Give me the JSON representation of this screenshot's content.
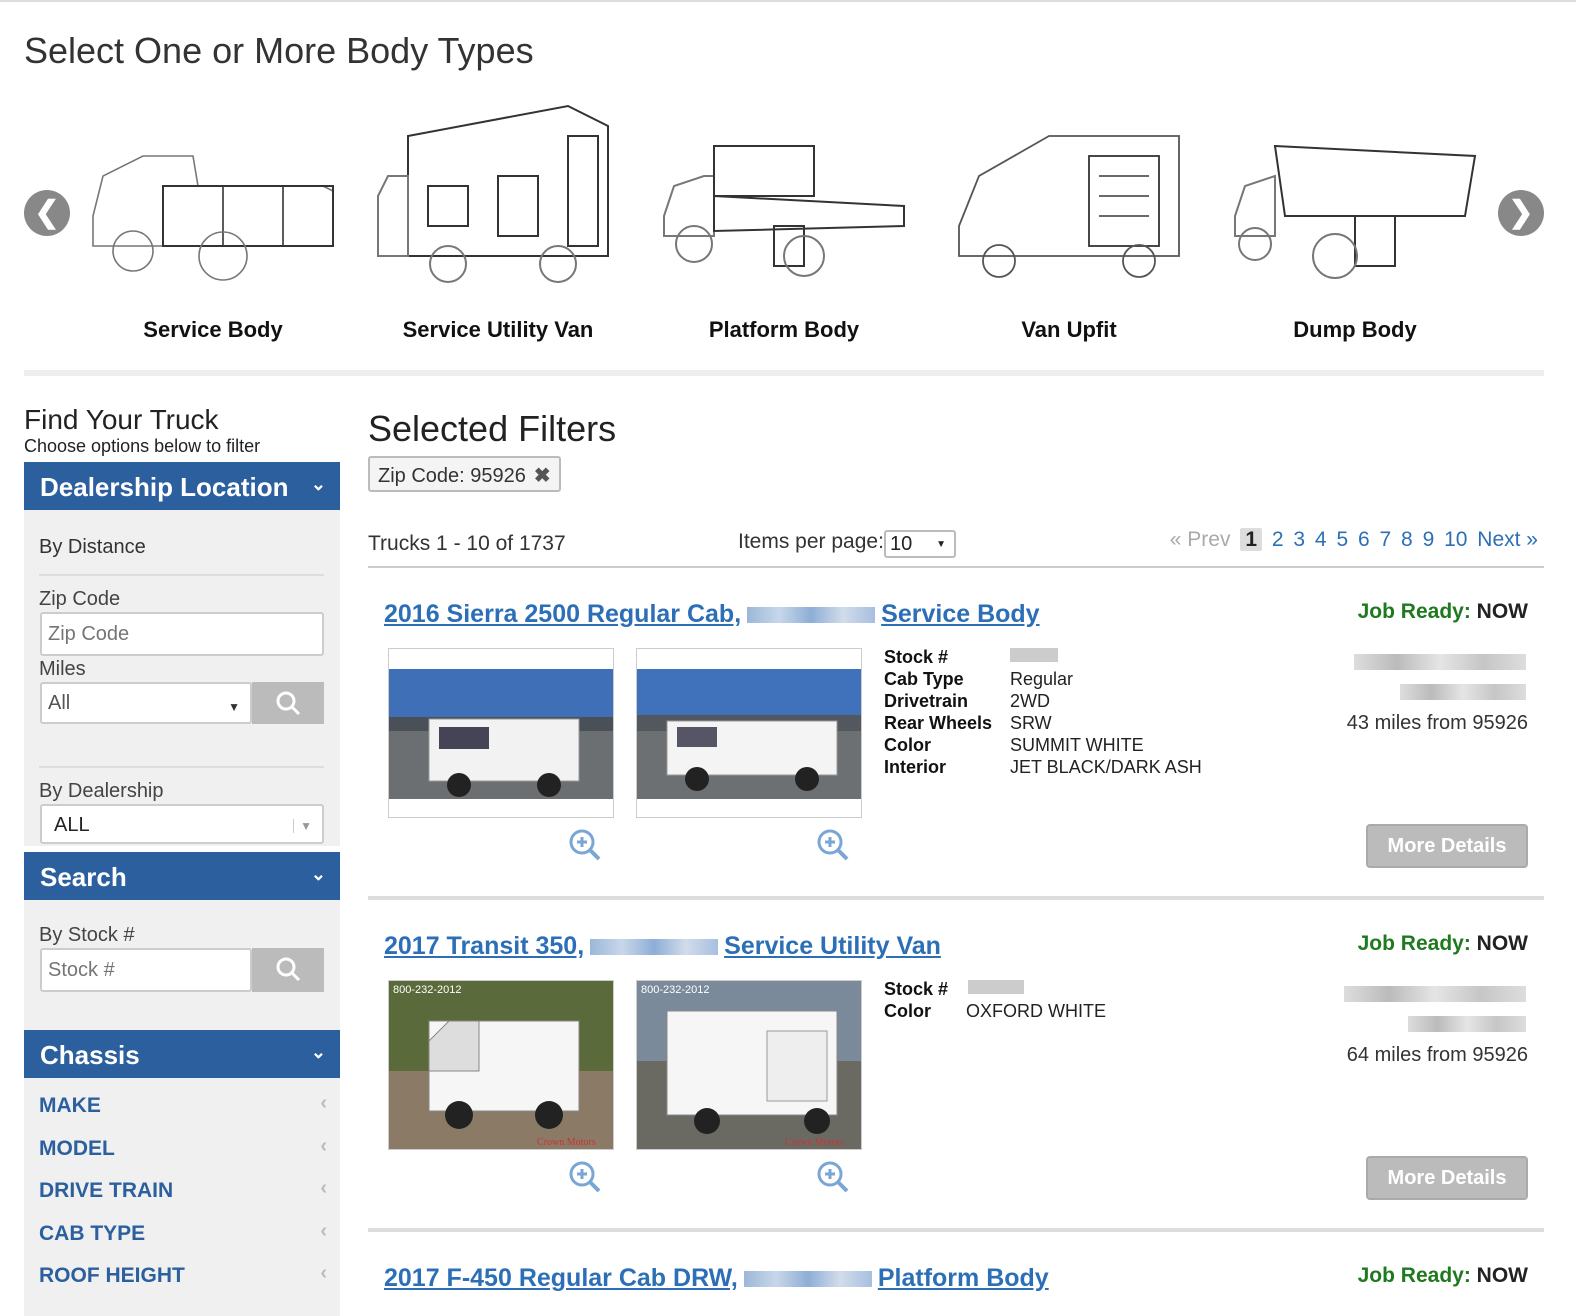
{
  "page": {
    "heading": "Select One or More Body Types"
  },
  "body_types": [
    {
      "label": "Service Body"
    },
    {
      "label": "Service Utility Van"
    },
    {
      "label": "Platform Body"
    },
    {
      "label": "Van Upfit"
    },
    {
      "label": "Dump Body"
    }
  ],
  "sidebar": {
    "title": "Find Your Truck",
    "subtitle": "Choose options below to filter",
    "dealership_location": {
      "header": "Dealership Location",
      "by_distance": "By Distance",
      "zip_label": "Zip Code",
      "zip_placeholder": "Zip Code",
      "miles_label": "Miles",
      "miles_value": "All",
      "by_dealership": "By Dealership",
      "dealership_value": "ALL"
    },
    "search": {
      "header": "Search",
      "by_stock": "By Stock #",
      "stock_placeholder": "Stock #"
    },
    "chassis": {
      "header": "Chassis",
      "items": [
        "MAKE",
        "MODEL",
        "DRIVE TRAIN",
        "CAB TYPE",
        "ROOF HEIGHT"
      ]
    }
  },
  "main": {
    "selected_filters_title": "Selected Filters",
    "filter_chip": "Zip Code: 95926",
    "count_text": "Trucks 1 - 10 of 1737",
    "items_per_page_label": "Items per page:",
    "items_per_page_value": "10",
    "pager": {
      "prev": "« Prev",
      "current": "1",
      "pages": [
        "2",
        "3",
        "4",
        "5",
        "6",
        "7",
        "8",
        "9",
        "10"
      ],
      "next": "Next »"
    }
  },
  "listings": [
    {
      "title_start": "2016 Sierra 2500 Regular Cab,",
      "title_end": "Service Body",
      "job_ready_label": "Job Ready:",
      "job_ready_value": "NOW",
      "specs": [
        {
          "key": "Stock #",
          "value": ""
        },
        {
          "key": "Cab Type",
          "value": "Regular"
        },
        {
          "key": "Drivetrain",
          "value": "2WD"
        },
        {
          "key": "Rear Wheels",
          "value": "SRW"
        },
        {
          "key": "Color",
          "value": "SUMMIT WHITE"
        },
        {
          "key": "Interior",
          "value": "JET BLACK/DARK ASH"
        }
      ],
      "miles_text": "43 miles from 95926",
      "button": "More Details"
    },
    {
      "title_start": "2017 Transit 350,",
      "title_end": "Service Utility Van",
      "job_ready_label": "Job Ready:",
      "job_ready_value": "NOW",
      "specs": [
        {
          "key": "Stock #",
          "value": ""
        },
        {
          "key": "Color",
          "value": "OXFORD WHITE"
        }
      ],
      "miles_text": "64 miles from 95926",
      "button": "More Details",
      "photo_phone": "800-232-2012",
      "photo_watermark": "Crown Motors"
    },
    {
      "title_start": "2017 F-450 Regular Cab DRW,",
      "title_end": "Platform Body",
      "job_ready_label": "Job Ready:",
      "job_ready_value": "NOW"
    }
  ],
  "colors": {
    "brand_blue": "#2c5f9e",
    "link_blue": "#2c6fb6",
    "job_ready_green": "#1f7a1f"
  }
}
